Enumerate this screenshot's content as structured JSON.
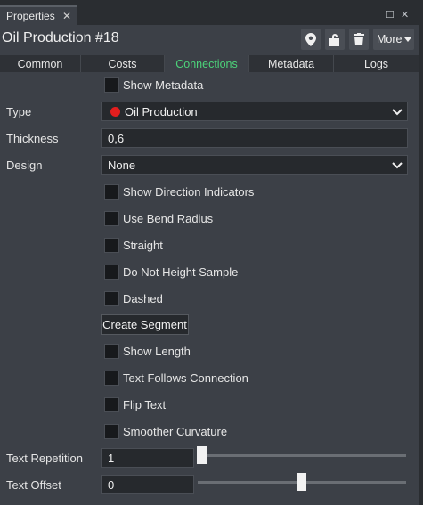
{
  "panel": {
    "tab_label": "Properties",
    "close_glyph": "✕"
  },
  "header": {
    "title": "Oil Production #18",
    "more_label": "More"
  },
  "tabs": [
    {
      "label": "Common"
    },
    {
      "label": "Costs"
    },
    {
      "label": "Connections",
      "active": true
    },
    {
      "label": "Metadata"
    },
    {
      "label": "Logs"
    }
  ],
  "form": {
    "show_metadata": "Show Metadata",
    "type_label": "Type",
    "type_value": "Oil Production",
    "type_color": "#e41e1e",
    "thickness_label": "Thickness",
    "thickness_value": "0,6",
    "design_label": "Design",
    "design_value": "None",
    "checkboxes": [
      "Show Direction Indicators",
      "Use Bend Radius",
      "Straight",
      "Do Not Height Sample",
      "Dashed"
    ],
    "create_segment": "Create Segment",
    "checkboxes2": [
      "Show Length",
      "Text Follows Connection",
      "Flip Text",
      "Smoother Curvature"
    ],
    "text_repetition_label": "Text Repetition",
    "text_repetition_value": "1",
    "text_repetition_level": 0.0,
    "text_offset_label": "Text Offset",
    "text_offset_value": "0",
    "text_offset_level": 0.5
  },
  "colors": {
    "accent": "#4cd37a",
    "background": "#3c4047"
  }
}
